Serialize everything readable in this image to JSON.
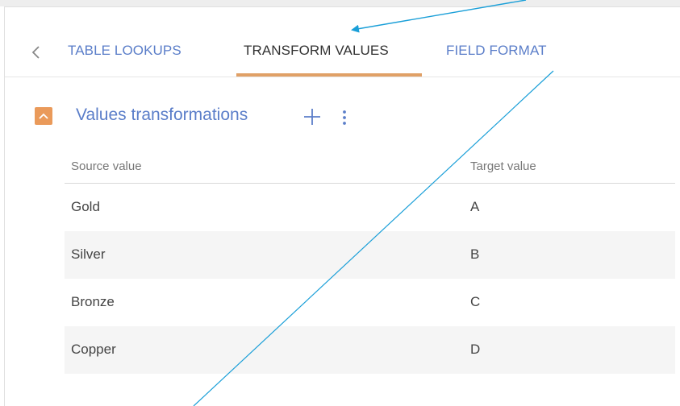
{
  "tabs": {
    "back_icon": "chevron-left-icon",
    "items": [
      {
        "label": "TABLE LOOKUPS",
        "active": false
      },
      {
        "label": "TRANSFORM VALUES",
        "active": true
      },
      {
        "label": "FIELD FORMAT",
        "active": false
      }
    ]
  },
  "section": {
    "title": "Values transformations",
    "toggle_icon": "chevron-up-icon",
    "add_icon": "plus-icon",
    "more_icon": "more-vertical-icon"
  },
  "table": {
    "columns": [
      "Source value",
      "Target value"
    ],
    "rows": [
      {
        "source": "Gold",
        "target": "A"
      },
      {
        "source": "Silver",
        "target": "B"
      },
      {
        "source": "Bronze",
        "target": "C"
      },
      {
        "source": "Copper",
        "target": "D"
      }
    ]
  },
  "colors": {
    "accent": "#5b7ec9",
    "active_underline": "#e0a066",
    "toggle": "#ea9a5a",
    "annotation_arrow": "#1a9fd8"
  }
}
